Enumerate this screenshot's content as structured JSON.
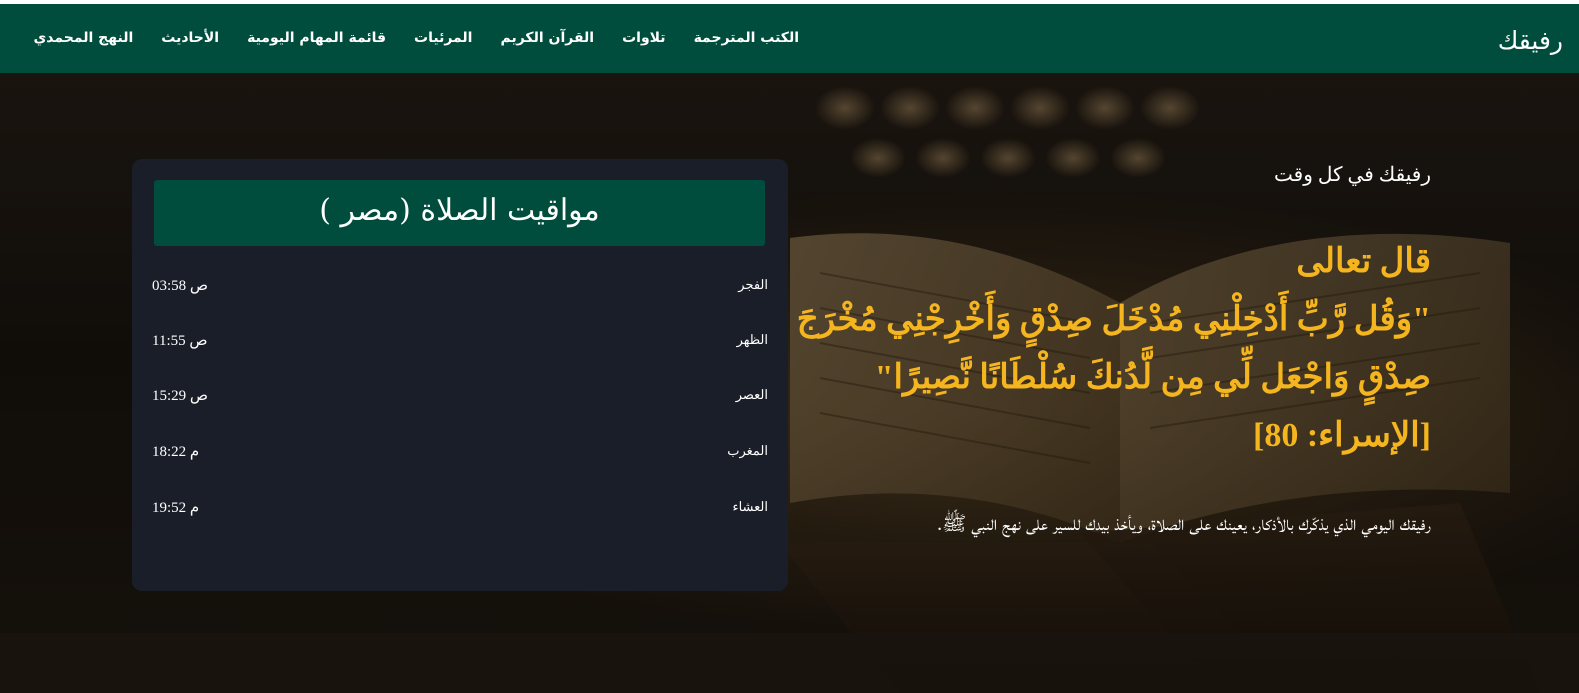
{
  "navbar": {
    "brand": "رفيقك",
    "links": [
      "النهج المحمدي",
      "الأحاديث",
      "قائمة المهام اليومية",
      "المرئيات",
      "القرآن الكريم",
      "تلاوات",
      "الكتب المترجمة"
    ],
    "background_color": "#004d3d"
  },
  "hero": {
    "tagline": "رفيقك في كل وقت",
    "verse": {
      "intro": "قال تعالى",
      "line1": "\"وَقُل رَّبِّ أَدْخِلْنِي مُدْخَلَ صِدْقٍ وَأَخْرِجْنِي مُخْرَجَ",
      "line2": "صِدْقٍ وَاجْعَل لِّي مِن لَّدُنكَ سُلْطَانًا نَّصِيرًا\"",
      "reference": "[الإسراء: 80]",
      "color": "#f5b51f"
    },
    "description": "رفيقك اليومي الذي يذكّرك بالأذكار، يعينك على الصلاة، ويأخذ بيدك للسير على نهج النبي ﷺ."
  },
  "prayer_times": {
    "title": "مواقيت الصلاة (مصر )",
    "rows": [
      {
        "name": "الفجر",
        "time": "03:58 ص"
      },
      {
        "name": "الظهر",
        "time": "11:55 ص"
      },
      {
        "name": "العصر",
        "time": "15:29 ص"
      },
      {
        "name": "المغرب",
        "time": "18:22 م"
      },
      {
        "name": "العشاء",
        "time": "19:52 م"
      }
    ]
  }
}
